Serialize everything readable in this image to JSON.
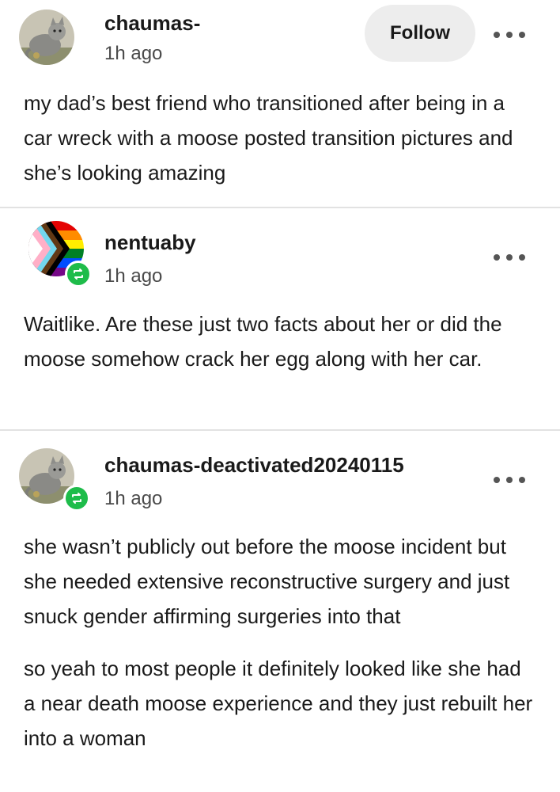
{
  "posts": [
    {
      "username": "chaumas-",
      "time": "1h ago",
      "follow_label": "Follow",
      "avatar": "gray-cat-illustration-avatar",
      "body": [
        "my dad’s best friend who transitioned after being in a car wreck with a moose posted transition pictures and she’s looking amazing"
      ]
    },
    {
      "username": "nentuaby",
      "time": "1h ago",
      "avatar": "progress-pride-flag-avatar",
      "body": [
        "Waitlike. Are these just two facts about her or did the moose somehow crack her egg along with her car."
      ]
    },
    {
      "username": "chaumas-deactivated20240115",
      "time": "1h ago",
      "avatar": "gray-cat-illustration-avatar",
      "body": [
        "she wasn’t publicly out before the moose incident but she needed extensive reconstructive surgery and just snuck gender affirming surgeries into that",
        "so yeah to most people it definitely looked like she had a near death moose experience and they just rebuilt her into a woman"
      ]
    }
  ],
  "colors": {
    "reblog_badge": "#1ebc4a",
    "divider": "#e2e2e2",
    "follow_bg": "#ededed"
  },
  "icons": {
    "more": "more-options-icon",
    "reblog": "reblog-icon"
  }
}
